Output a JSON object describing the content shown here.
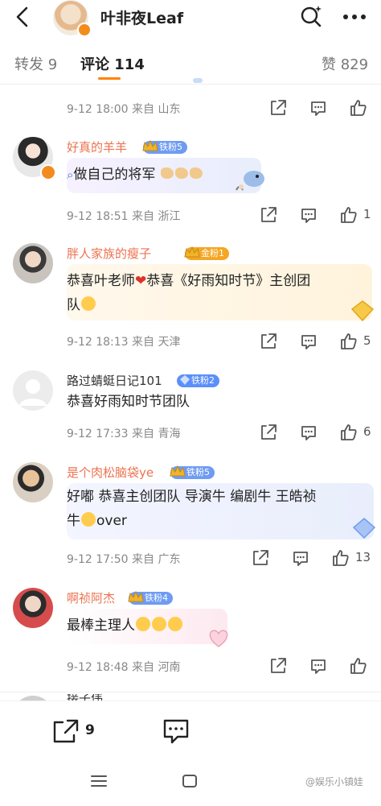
{
  "header": {
    "title": "叶非夜Leaf"
  },
  "tabs": {
    "repost": "转发 9",
    "comments": "评论 114",
    "likes": "赞 829"
  },
  "comments": [
    {
      "meta": "9-12 18:00  来自 山东"
    },
    {
      "name": "好真的羊羊",
      "fan": "铁粉5",
      "text": "做自己的将军",
      "meta": "9-12 18:51  来自 浙江",
      "likes": "1"
    },
    {
      "name": "胖人家族的瘦子",
      "fan": "金粉1",
      "text_a": "恭喜叶老师",
      "text_b": "恭喜《好雨知时节》主创团",
      "text_c": "队",
      "meta": "9-12 18:13  来自 天津",
      "likes": "5"
    },
    {
      "name": "路过蜻蜓日记101",
      "fan": "铁粉2",
      "text": "恭喜好雨知时节团队",
      "meta": "9-12 17:33  来自 青海",
      "likes": "6"
    },
    {
      "name": "是个肉松脑袋ye",
      "fan": "铁粉5",
      "text_a": "好嘟 恭喜主创团队 导演牛 编剧牛 王皓祯",
      "text_b": "牛",
      "text_c": "over",
      "meta": "9-12 17:50  来自 广东",
      "likes": "13"
    },
    {
      "name": "啊祯阿杰",
      "fan": "铁粉4",
      "text": "最棒主理人",
      "meta": "9-12 18:48  来自 河南"
    },
    {
      "name": "接子伟"
    }
  ],
  "bottom": {
    "repost_count": "9"
  },
  "watermark": "@娱乐小镇娃",
  "colors": {
    "accent": "#ff8200",
    "username": "#eb7350",
    "iron_fan": "#5b8ff9",
    "gold_fan": "#f5a623"
  }
}
